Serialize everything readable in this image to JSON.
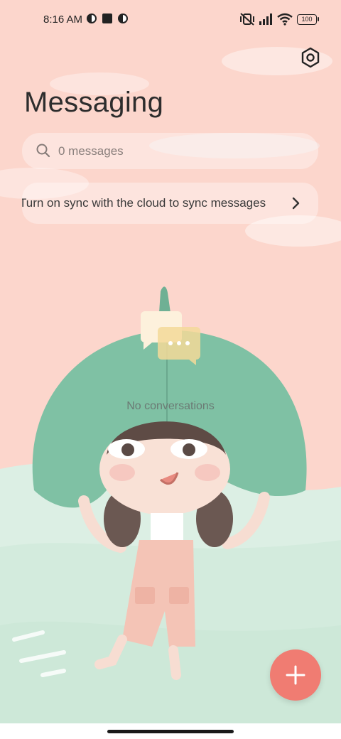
{
  "status_bar": {
    "time": "8:16 AM",
    "battery": "100",
    "icons": [
      "app-notification-icon",
      "square-notification-icon",
      "app-notification-icon",
      "vibrate-off-icon",
      "signal-icon",
      "wifi-icon",
      "battery-icon"
    ]
  },
  "header": {
    "title": "Messaging",
    "settings_icon": "settings-hex-icon"
  },
  "search": {
    "placeholder": "0 messages",
    "icon": "search-icon"
  },
  "sync_banner": {
    "text": "Turn on sync with the cloud to sync messages",
    "icon": "chevron-right-icon"
  },
  "empty_state": {
    "label": "No conversations",
    "icon": "chat-bubbles-icon"
  },
  "fab": {
    "icon": "plus-icon"
  },
  "colors": {
    "background": "#fcd6cc",
    "fab": "#f07c72",
    "leaf": "#7fc1a4",
    "water": "#dcefe4"
  }
}
